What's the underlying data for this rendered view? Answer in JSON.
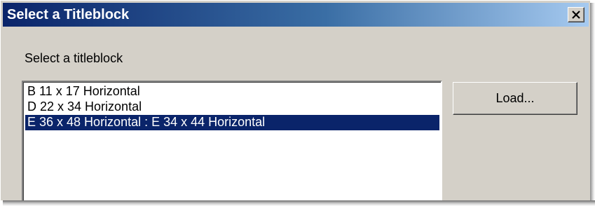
{
  "dialog": {
    "title": "Select a Titleblock",
    "close_icon": "close-icon",
    "prompt": "Select a titleblock"
  },
  "titleblocks": {
    "items": [
      {
        "label": "B 11 x 17 Horizontal",
        "selected": false
      },
      {
        "label": "D 22 x 34 Horizontal",
        "selected": false
      },
      {
        "label": "E 36 x 48 Horizontal : E 34 x 44 Horizontal",
        "selected": true
      }
    ]
  },
  "buttons": {
    "load_label": "Load..."
  },
  "colors": {
    "title_gradient_start": "#0a246a",
    "title_gradient_end": "#a6caf0",
    "selection": "#0a246a",
    "face": "#d4d0c8"
  }
}
